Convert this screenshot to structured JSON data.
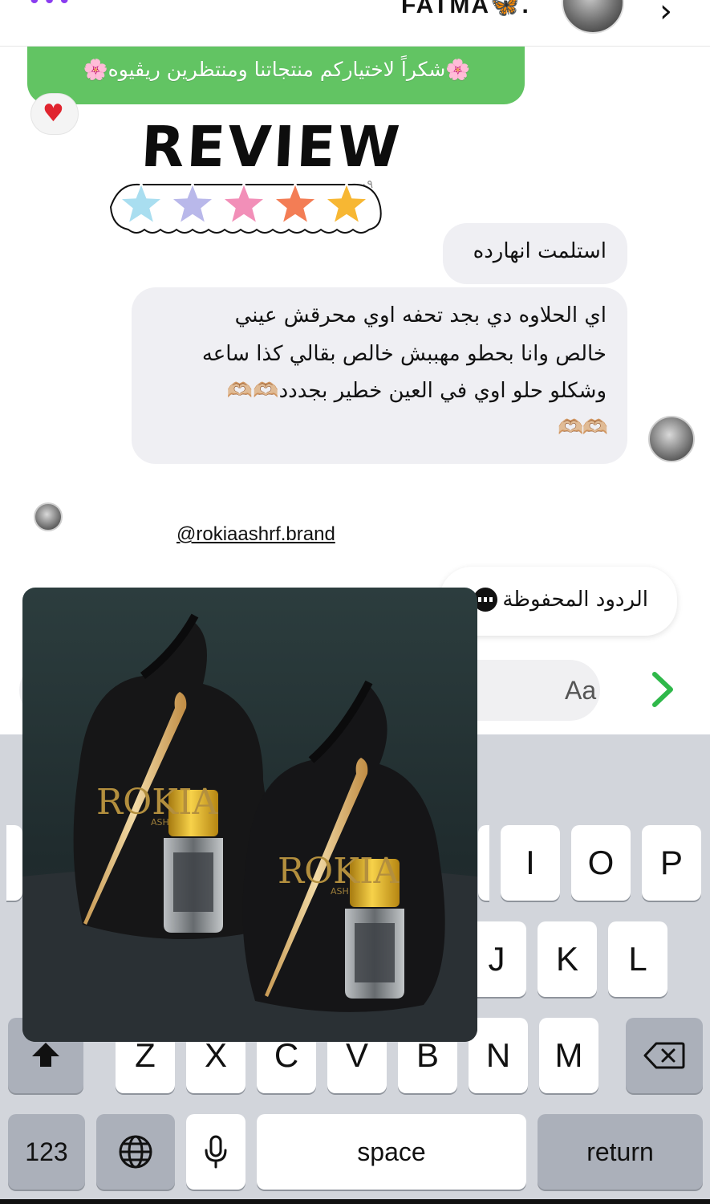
{
  "header": {
    "menu_icon": "more-dots-icon",
    "contact_name": "FATMA🦋.",
    "back_icon": "chevron-right-icon"
  },
  "banner": {
    "text": "🌸شكراً لاختياركم منتجاتنا ومنتظرين ريڤيوه🌸",
    "background_color": "#62c463",
    "reaction": "❤️"
  },
  "review_sticker": {
    "title": "REVIEW",
    "timestamp": "٠٩",
    "star_colors": [
      "#a9def0",
      "#b9b8ea",
      "#f28fb8",
      "#f37d55",
      "#f7b733"
    ],
    "rating": 5
  },
  "messages": [
    {
      "text": "استلمت انهارده"
    },
    {
      "lines": [
        "اي الحلاوه دي بجد تحفه اوي محرقش عيني",
        "خالص وانا بحطو مهببش خالص بقالي كذا ساعه",
        "وشكلو حلو اوي في العين خطير بجددد🫶🏼🫶🏼",
        "🫶🏼🫶🏼"
      ]
    }
  ],
  "mention": "@rokiaashrf.brand",
  "saved_replies": {
    "label": "الردود المحفوظة",
    "icon": "saved-replies-icon"
  },
  "composer": {
    "placeholder": "Aa",
    "send_icon": "chevron-right-icon",
    "accent_color": "#2fb84a"
  },
  "product_photo": {
    "brand_text": "ROKIA",
    "brand_subtext": "ASH"
  },
  "keyboard": {
    "row1": [
      "I",
      "O",
      "P"
    ],
    "row2": [
      "J",
      "K",
      "L"
    ],
    "row3": [
      "Z",
      "X",
      "C",
      "V",
      "B",
      "N",
      "M"
    ],
    "shift_icon": "shift-icon",
    "backspace_icon": "backspace-icon",
    "numbers_label": "123",
    "globe_icon": "globe-icon",
    "mic_icon": "microphone-icon",
    "space_label": "space",
    "return_label": "return"
  }
}
